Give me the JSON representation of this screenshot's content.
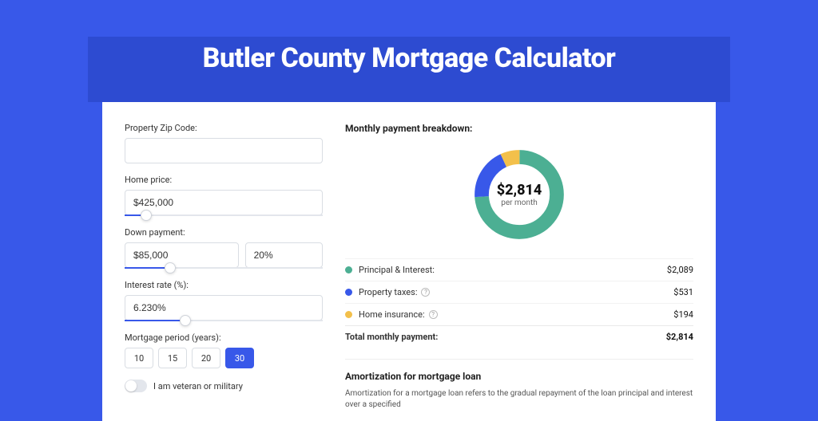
{
  "title": "Butler County Mortgage Calculator",
  "form": {
    "zip": {
      "label": "Property Zip Code:",
      "value": ""
    },
    "home_price": {
      "label": "Home price:",
      "value": "$425,000",
      "slider_pct": 8
    },
    "down_payment": {
      "label": "Down payment:",
      "amount": "$85,000",
      "pct": "20%",
      "slider_pct": 20
    },
    "interest": {
      "label": "Interest rate (%):",
      "value": "6.230%",
      "slider_pct": 28
    },
    "period": {
      "label": "Mortgage period (years):",
      "options": [
        "10",
        "15",
        "20",
        "30"
      ],
      "selected": "30"
    },
    "veteran": {
      "label": "I am veteran or military",
      "checked": false
    }
  },
  "breakdown": {
    "title": "Monthly payment breakdown:",
    "center_amount": "$2,814",
    "center_sub": "per month",
    "items": [
      {
        "label": "Principal & Interest:",
        "value": "$2,089",
        "color": "#4caf93",
        "has_info": false,
        "pct": 74
      },
      {
        "label": "Property taxes:",
        "value": "$531",
        "color": "#3858e9",
        "has_info": true,
        "pct": 19
      },
      {
        "label": "Home insurance:",
        "value": "$194",
        "color": "#f3c04b",
        "has_info": true,
        "pct": 7
      }
    ],
    "total_label": "Total monthly payment:",
    "total_value": "$2,814"
  },
  "amortization": {
    "title": "Amortization for mortgage loan",
    "text": "Amortization for a mortgage loan refers to the gradual repayment of the loan principal and interest over a specified"
  }
}
